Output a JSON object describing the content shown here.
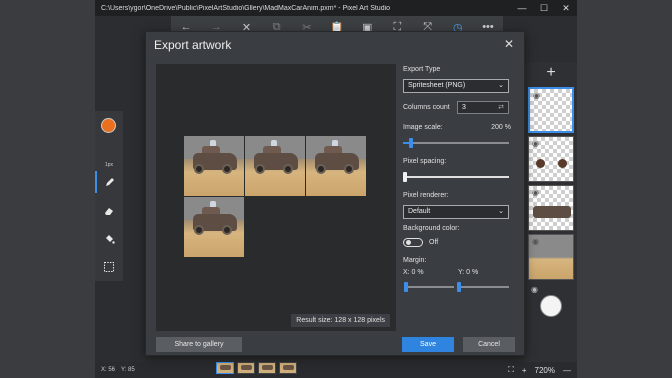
{
  "window": {
    "title": "C:\\Users\\ygor\\OneDrive\\Public\\PixelArtStudio\\Gllery\\MadMaxCarAnim.pxm* - Pixel Art Studio",
    "minimize": "—",
    "maximize": "☐",
    "close": "✕"
  },
  "toolbar": {
    "back": "←",
    "forward": "→",
    "close": "✕",
    "copy": "⧉",
    "cut": "✂",
    "paste": "📋",
    "resize": "▣",
    "select": "⛶",
    "flip": "⤧",
    "timer": "◷",
    "more": "•••"
  },
  "tools": {
    "pixel_size": "1px"
  },
  "dialog": {
    "title": "Export artwork",
    "close": "✕",
    "result_size": "Result size: 128 x 128  pixels",
    "export_type_label": "Export Type",
    "export_type_value": "Spritesheet (PNG)",
    "columns_label": "Columns count",
    "columns_value": "3",
    "image_scale_label": "Image scale:",
    "image_scale_value": "200 %",
    "image_scale_fraction": 0.08,
    "pixel_spacing_label": "Pixel spacing:",
    "pixel_spacing_fraction": 0.0,
    "pixel_renderer_label": "Pixel renderer:",
    "pixel_renderer_value": "Default",
    "background_color_label": "Background color:",
    "background_toggle_text": "Off",
    "margin_label": "Margin:",
    "margin_x_label": "X: 0 %",
    "margin_y_label": "Y: 0 %",
    "share_button": "Share to gallery",
    "save_button": "Save",
    "cancel_button": "Cancel"
  },
  "status": {
    "x": "X: 56",
    "y": "Y: 85",
    "zoom": "720%"
  },
  "colors": {
    "accent": "#2f84e0",
    "primary_color": "#e8701e"
  }
}
